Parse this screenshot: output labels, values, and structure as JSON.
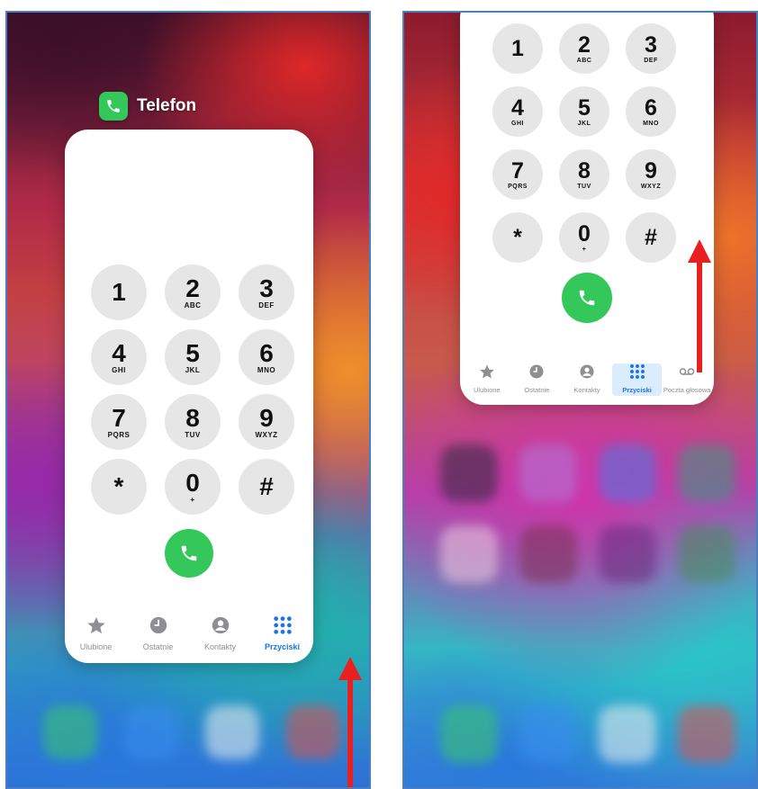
{
  "app": {
    "name": "Telefon"
  },
  "colors": {
    "accent": "#1a73e8",
    "call": "#34c759",
    "key": "#e6e6e6",
    "arrow": "#e8201f",
    "frame": "#4a7fc1"
  },
  "keypad": [
    {
      "digit": "1",
      "letters": ""
    },
    {
      "digit": "2",
      "letters": "ABC"
    },
    {
      "digit": "3",
      "letters": "DEF"
    },
    {
      "digit": "4",
      "letters": "GHI"
    },
    {
      "digit": "5",
      "letters": "JKL"
    },
    {
      "digit": "6",
      "letters": "MNO"
    },
    {
      "digit": "7",
      "letters": "PQRS"
    },
    {
      "digit": "8",
      "letters": "TUV"
    },
    {
      "digit": "9",
      "letters": "WXYZ"
    },
    {
      "digit": "*",
      "letters": ""
    },
    {
      "digit": "0",
      "letters": "+"
    },
    {
      "digit": "#",
      "letters": ""
    }
  ],
  "tabs_left": [
    {
      "label": "Ulubione",
      "icon": "star-icon"
    },
    {
      "label": "Ostatnie",
      "icon": "clock-icon"
    },
    {
      "label": "Kontakty",
      "icon": "person-icon"
    },
    {
      "label": "Przyciski",
      "icon": "keypad-icon",
      "active": true
    }
  ],
  "tabs_right": [
    {
      "label": "Ulubione",
      "icon": "star-icon"
    },
    {
      "label": "Ostatnie",
      "icon": "clock-icon"
    },
    {
      "label": "Kontakty",
      "icon": "person-icon"
    },
    {
      "label": "Przyciski",
      "icon": "keypad-icon",
      "active": true
    },
    {
      "label": "Poczta głosowa",
      "icon": "voicemail-icon"
    }
  ]
}
